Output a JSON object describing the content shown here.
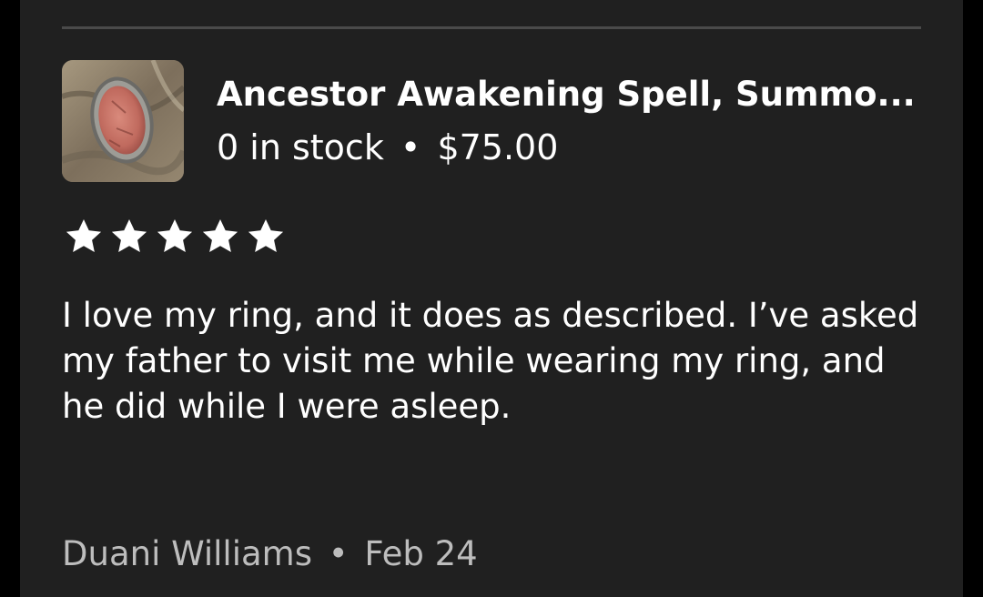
{
  "listing": {
    "title": "Ancestor Awakening Spell, Summo...",
    "stock": "0 in stock",
    "separator": "•",
    "price": "$75.00",
    "thumbnail_icon": "ring-photo"
  },
  "review": {
    "rating": 5,
    "rating_max": 5,
    "star_color": "#ffffff",
    "text": "I love my ring, and it does as described. I’ve asked my father to visit me while wearing my ring, and he did while I were asleep.",
    "author": "Duani Williams",
    "separator": "•",
    "date": "Feb 24"
  }
}
